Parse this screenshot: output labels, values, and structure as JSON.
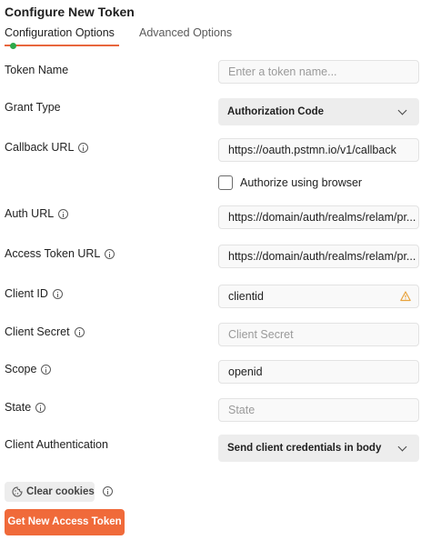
{
  "title": "Configure New Token",
  "tabs": [
    {
      "label": "Configuration Options",
      "active": true,
      "status_color": "#2eaa4a"
    },
    {
      "label": "Advanced Options",
      "active": false
    }
  ],
  "form": {
    "token_name": {
      "label": "Token Name",
      "value": "",
      "placeholder": "Enter a token name..."
    },
    "grant_type": {
      "label": "Grant Type",
      "selected": "Authorization Code"
    },
    "callback_url": {
      "label": "Callback URL",
      "value": "https://oauth.pstmn.io/v1/callback"
    },
    "authorize_browser": {
      "label": "Authorize using browser",
      "checked": false
    },
    "auth_url": {
      "label": "Auth URL",
      "value": "https://domain/auth/realms/relam/pr..."
    },
    "access_token_url": {
      "label": "Access Token URL",
      "value": "https://domain/auth/realms/relam/pr..."
    },
    "client_id": {
      "label": "Client ID",
      "value": "clientid",
      "warning_icon": "warning-icon",
      "warning_color": "#e8a33d"
    },
    "client_secret": {
      "label": "Client Secret",
      "value": "",
      "placeholder": "Client Secret"
    },
    "scope": {
      "label": "Scope",
      "value": "openid"
    },
    "state": {
      "label": "State",
      "value": "",
      "placeholder": "State"
    },
    "client_authentication": {
      "label": "Client Authentication",
      "selected": "Send client credentials in body"
    }
  },
  "actions": {
    "clear_cookies": "Clear cookies",
    "get_token": "Get New Access Token",
    "accent_color": "#f06a3a"
  }
}
